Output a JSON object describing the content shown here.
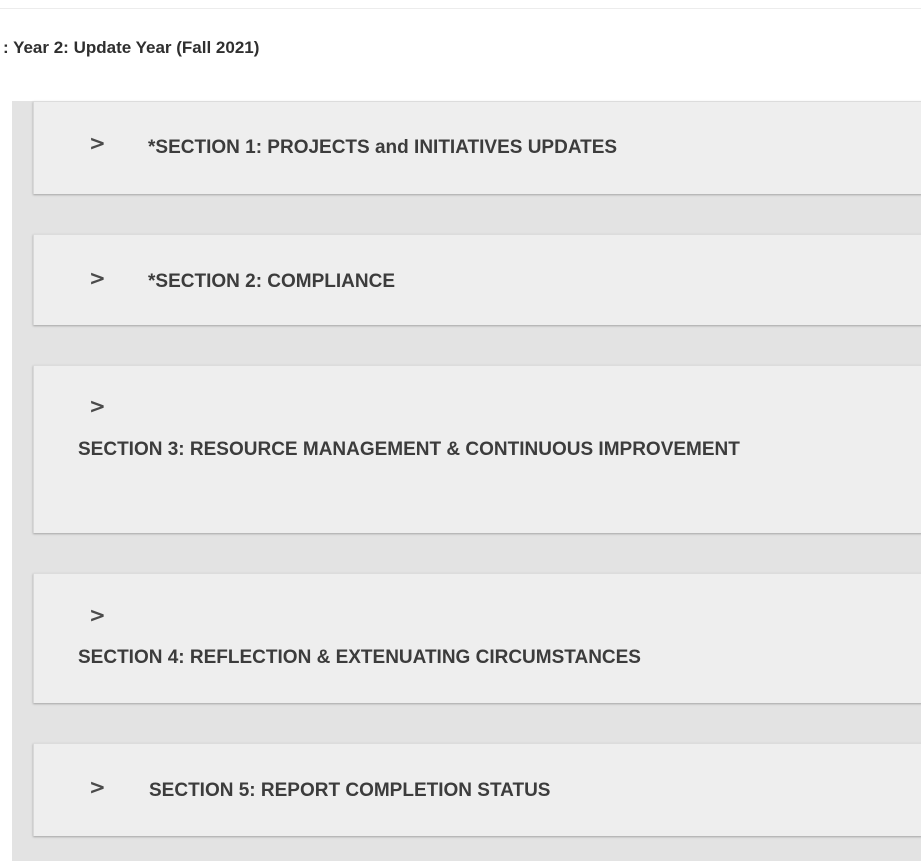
{
  "page": {
    "title": ": Year 2: Update Year (Fall 2021)"
  },
  "sections": [
    {
      "chevron": ">",
      "label": "*SECTION 1: PROJECTS and INITIATIVES UPDATES"
    },
    {
      "chevron": ">",
      "label": "*SECTION 2: COMPLIANCE"
    },
    {
      "chevron": ">",
      "label": "SECTION 3: RESOURCE MANAGEMENT & CONTINUOUS IMPROVEMENT"
    },
    {
      "chevron": ">",
      "label": "SECTION 4: REFLECTION & EXTENUATING CIRCUMSTANCES"
    },
    {
      "chevron": ">",
      "label": "SECTION 5: REPORT COMPLETION STATUS"
    }
  ],
  "icons": {
    "expand": "chevron-right-icon"
  },
  "colors": {
    "panel_bg": "#eeeeee",
    "group_bg": "#e3e3e3",
    "text": "#3c3c3c"
  }
}
